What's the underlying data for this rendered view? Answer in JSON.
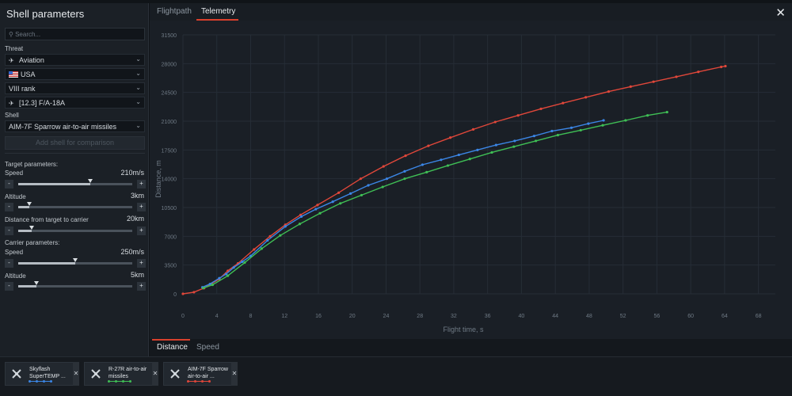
{
  "panel": {
    "title": "Shell parameters",
    "search_placeholder": "Search...",
    "threat_label": "Threat",
    "threat_category": "Aviation",
    "nation": "USA",
    "rank": "VIII rank",
    "vehicle": "[12.3] F/A-18A",
    "shell_label": "Shell",
    "shell": "AIM-7F Sparrow air-to-air missiles",
    "add_shell": "Add shell for comparison",
    "target_params_label": "Target parameters:",
    "carrier_params_label": "Carrier parameters:",
    "minus": "-",
    "plus": "+",
    "chevron": "⌄",
    "params": [
      {
        "label": "Speed",
        "value": "210m/s",
        "level": 0.63
      },
      {
        "label": "Altitude",
        "value": "3km",
        "level": 0.1
      },
      {
        "label": "Distance from target to carrier",
        "value": "20km",
        "level": 0.12
      },
      {
        "label": "Speed",
        "value": "250m/s",
        "level": 0.5
      },
      {
        "label": "Altitude",
        "value": "5km",
        "level": 0.16
      }
    ]
  },
  "tabs": {
    "flightpath": "Flightpath",
    "telemetry": "Telemetry",
    "close": "✕"
  },
  "bottom_tabs": {
    "distance": "Distance",
    "speed": "Speed"
  },
  "tray": {
    "cards": [
      {
        "name": "Skyflash SuperTEMP ...",
        "color": "#3b86e6",
        "remove": "✕"
      },
      {
        "name": "R-27R air-to-air missiles",
        "color": "#3fbf55",
        "remove": "✕"
      },
      {
        "name": "AIM-7F Sparrow air-to-air ...",
        "color": "#e0473a",
        "remove": "✕"
      }
    ]
  },
  "chart_data": {
    "type": "line",
    "xlabel": "Flight time, s",
    "ylabel": "Distance, m",
    "xlim": [
      0,
      70
    ],
    "ylim": [
      0,
      31500
    ],
    "xticks": [
      0,
      4,
      8,
      12,
      16,
      20,
      24,
      28,
      32,
      36,
      40,
      44,
      48,
      52,
      56,
      60,
      64,
      68
    ],
    "yticks": [
      0,
      3500,
      7000,
      10500,
      14000,
      17500,
      21000,
      24500,
      28000,
      31500
    ],
    "grid": true,
    "series": [
      {
        "color": "#e0473a",
        "x": [
          0,
          1.3,
          2.5,
          4.3,
          5.3,
          6.5,
          8.4,
          10.3,
          12.1,
          13.9,
          15.9,
          18.4,
          21,
          23.7,
          26.3,
          29,
          31.6,
          34.3,
          36.9,
          39.6,
          42.3,
          44.9,
          47.6,
          50.3,
          52.9,
          55.6,
          58.3,
          60.9,
          63.6,
          64.1
        ],
        "y": [
          0,
          200,
          700,
          1800,
          2800,
          3700,
          5400,
          7000,
          8400,
          9600,
          10800,
          12300,
          14000,
          15500,
          16800,
          18000,
          19000,
          20000,
          20900,
          21700,
          22500,
          23200,
          23900,
          24600,
          25200,
          25800,
          26400,
          27000,
          27600,
          27700
        ]
      },
      {
        "color": "#3b86e6",
        "x": [
          2.3,
          3.2,
          4.3,
          5.1,
          6.0,
          7.0,
          8.0,
          10.0,
          12.1,
          14.0,
          15.7,
          17.7,
          19.8,
          21.9,
          24.1,
          26.2,
          28.3,
          30.5,
          32.6,
          34.8,
          37.0,
          39.2,
          41.5,
          43.6,
          45.9,
          47.9,
          49.7
        ],
        "y": [
          800,
          1200,
          1900,
          2400,
          3200,
          3900,
          4600,
          6500,
          8200,
          9400,
          10300,
          11200,
          12200,
          13200,
          14000,
          14900,
          15700,
          16300,
          16900,
          17500,
          18100,
          18600,
          19200,
          19800,
          20200,
          20700,
          21100
        ]
      },
      {
        "color": "#3fbf55",
        "x": [
          2.4,
          3.5,
          5.3,
          7.3,
          9.3,
          11.5,
          13.8,
          16.2,
          18.6,
          21.1,
          23.6,
          26.2,
          28.8,
          31.3,
          33.9,
          36.5,
          39.1,
          41.7,
          44.3,
          47.0,
          49.6,
          52.3,
          54.9,
          57.2
        ],
        "y": [
          700,
          1100,
          2200,
          3800,
          5500,
          7100,
          8500,
          9800,
          11000,
          12000,
          13000,
          14000,
          14800,
          15600,
          16400,
          17200,
          17900,
          18600,
          19300,
          19900,
          20500,
          21100,
          21700,
          22100
        ]
      }
    ]
  }
}
